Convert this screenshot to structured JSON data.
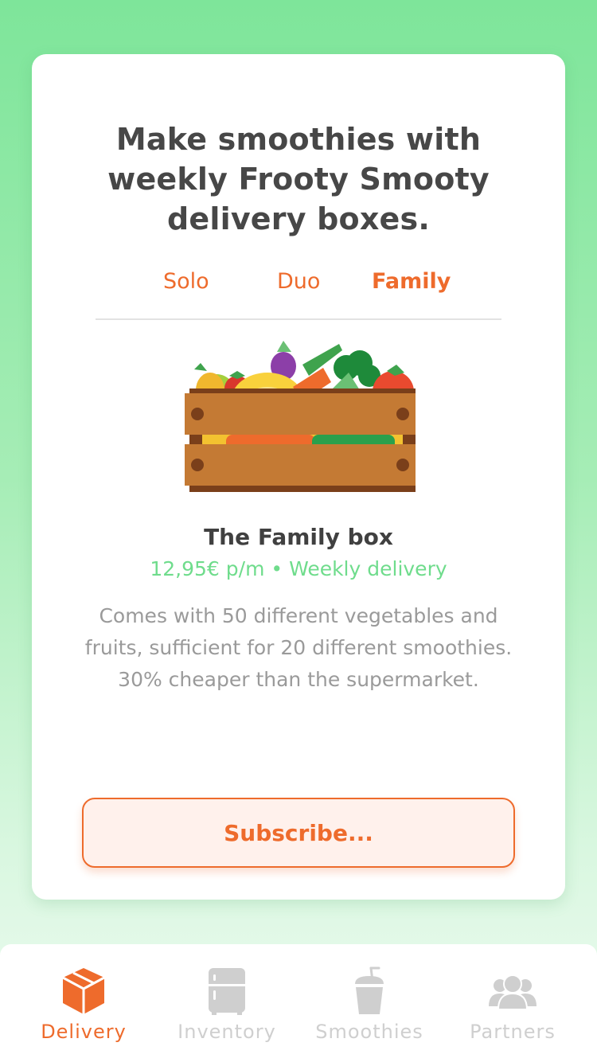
{
  "card": {
    "headline": "Make smoothies with weekly Frooty Smooty delivery boxes.",
    "tabs": [
      {
        "label": "Solo",
        "active": false
      },
      {
        "label": "Duo",
        "active": false
      },
      {
        "label": "Family",
        "active": true
      }
    ],
    "box": {
      "title": "The Family box",
      "price_line": "12,95€ p/m • Weekly delivery",
      "description": "Comes with 50 different vegetables and fruits, sufficient for 20 different smoothies. 30% cheaper than the supermarket."
    },
    "subscribe_label": "Subscribe..."
  },
  "tabbar": {
    "items": [
      {
        "label": "Delivery",
        "icon": "delivery-box-icon",
        "active": true
      },
      {
        "label": "Inventory",
        "icon": "fridge-icon",
        "active": false
      },
      {
        "label": "Smoothies",
        "icon": "smoothie-cup-icon",
        "active": false
      },
      {
        "label": "Partners",
        "icon": "people-icon",
        "active": false
      }
    ]
  },
  "colors": {
    "accent": "#ee6b2c",
    "price_green": "#6fdc8c",
    "background_green": "#7ee59a",
    "inactive_gray": "#cfcfcf",
    "text_dark": "#474747"
  }
}
